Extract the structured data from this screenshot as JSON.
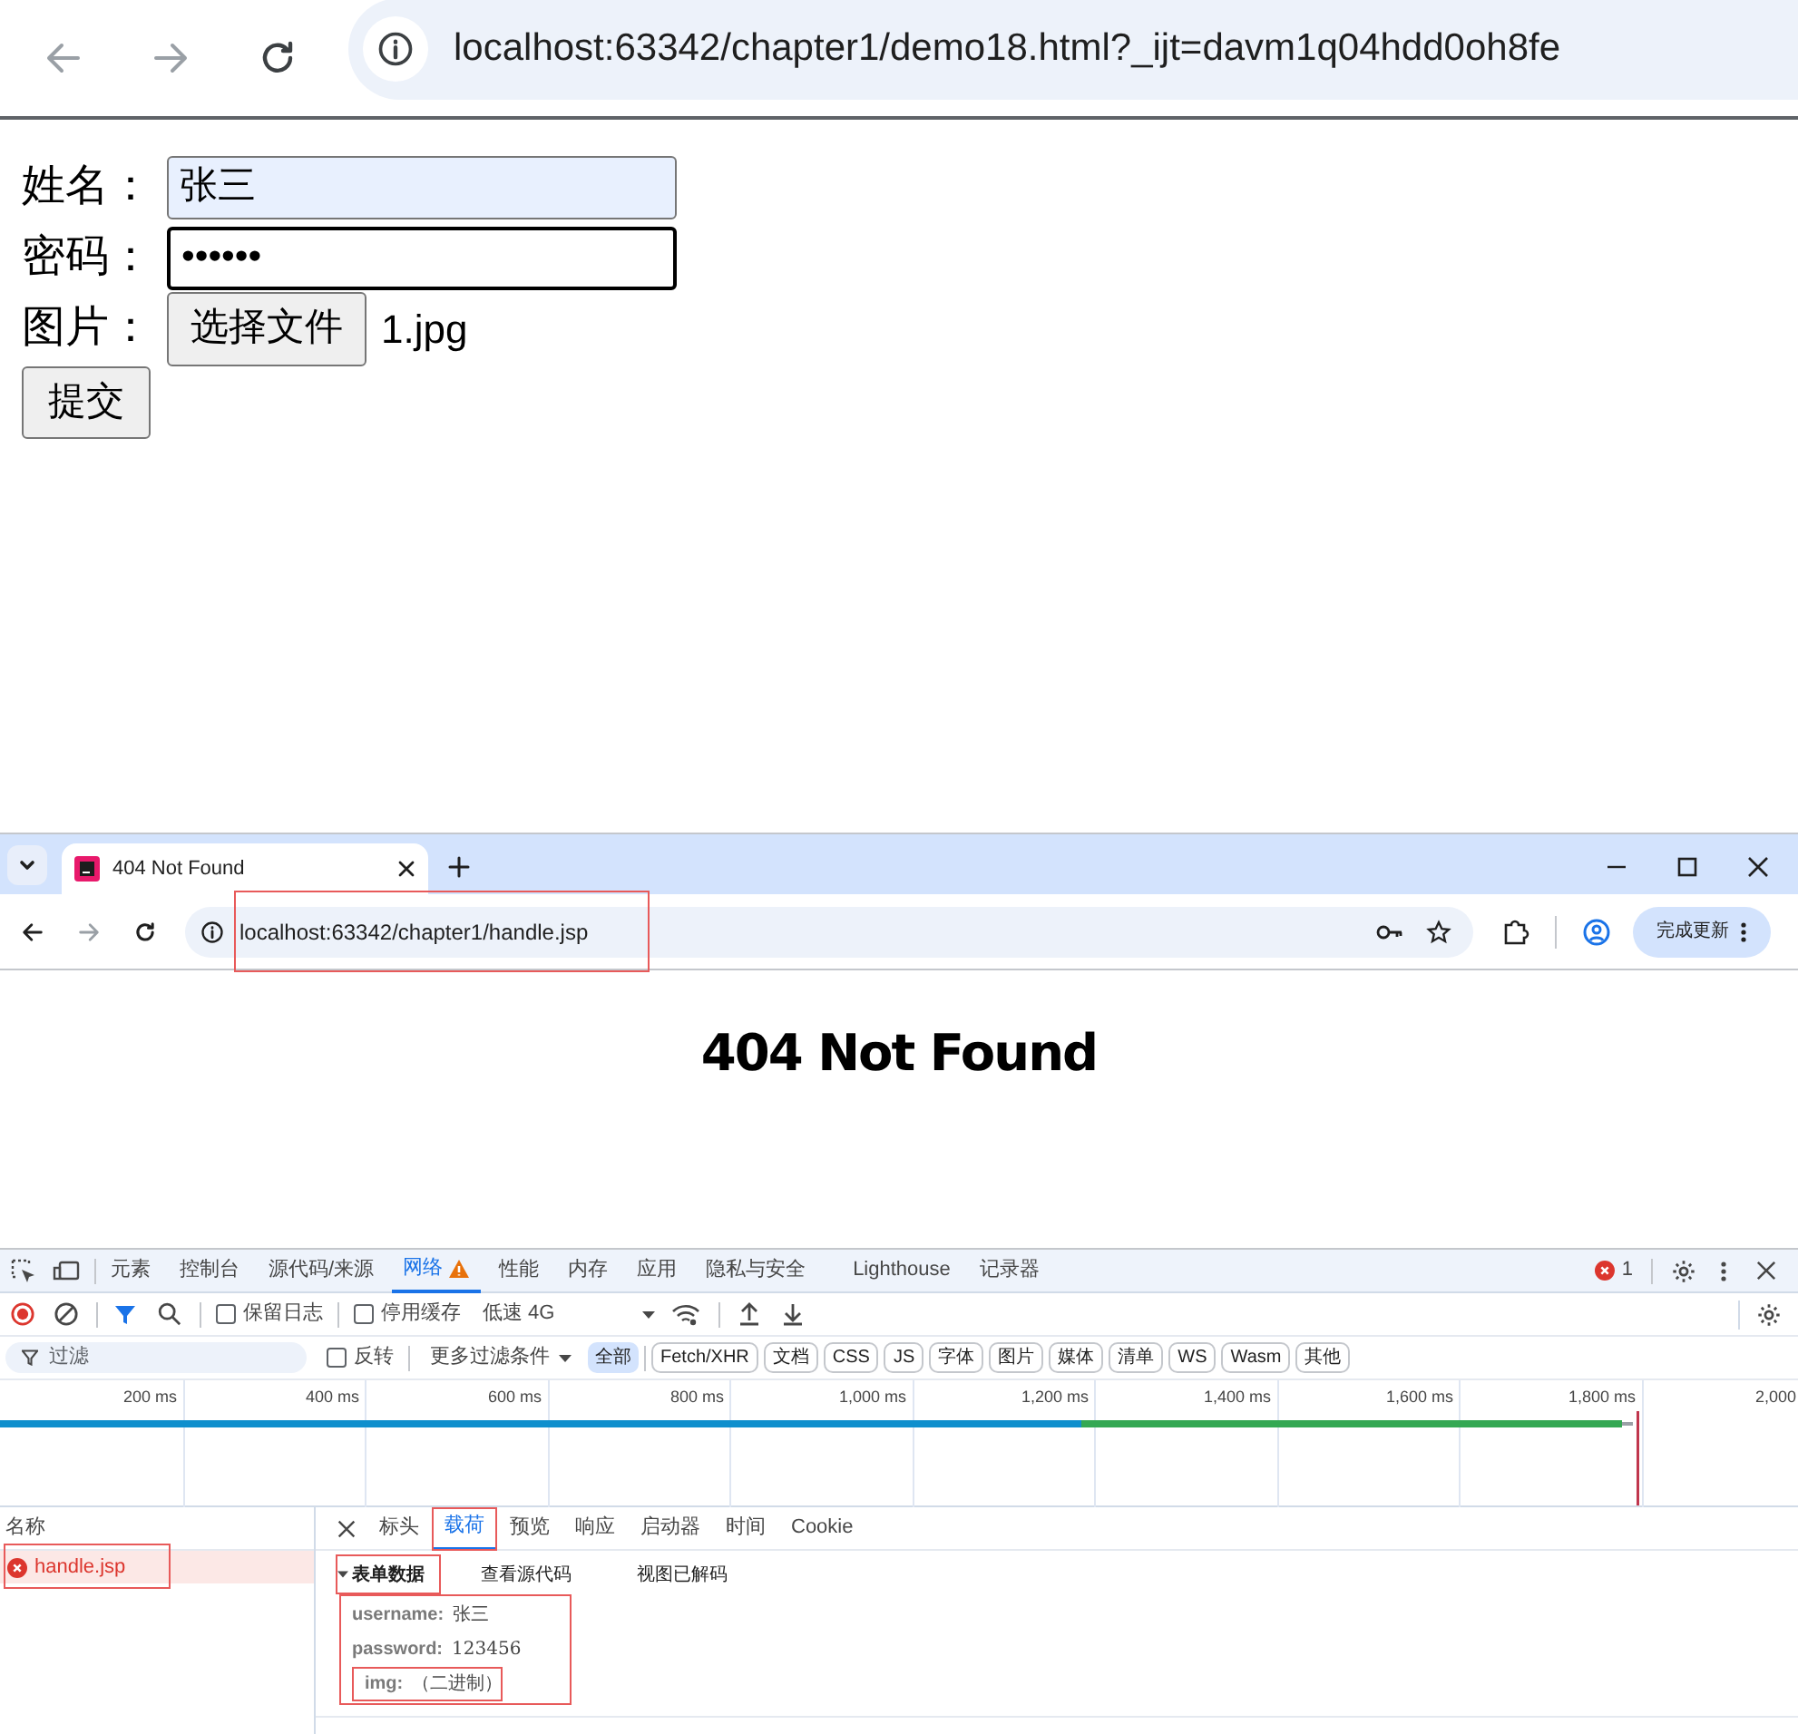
{
  "top_browser": {
    "url": "localhost:63342/chapter1/demo18.html?_ijt=davm1q04hdd0oh8fe"
  },
  "form": {
    "rows": [
      {
        "kind": "text",
        "label": "姓名：",
        "value": "张三",
        "autofilled": true,
        "focused": false
      },
      {
        "kind": "password",
        "label": "密码：",
        "value": "••••••",
        "autofilled": false,
        "focused": true
      },
      {
        "kind": "file",
        "label": "图片：",
        "button": "选择文件",
        "file_name": "1.jpg"
      }
    ],
    "submit": "提交"
  },
  "second_browser": {
    "tab_title": "404 Not Found",
    "url": "localhost:63342/chapter1/handle.jsp",
    "url_highlighted": true,
    "update_button": "完成更新",
    "heading": "404 Not Found"
  },
  "devtools": {
    "tabs": [
      {
        "label": "元素",
        "selected": false
      },
      {
        "label": "控制台",
        "selected": false
      },
      {
        "label": "源代码/来源",
        "selected": false
      },
      {
        "label": "网络",
        "selected": true,
        "warning": true
      },
      {
        "label": "性能",
        "selected": false
      },
      {
        "label": "内存",
        "selected": false
      },
      {
        "label": "应用",
        "selected": false
      },
      {
        "label": "隐私与安全",
        "selected": false
      },
      {
        "label": "Lighthouse",
        "selected": false
      },
      {
        "label": "记录器",
        "selected": false
      }
    ],
    "error_count": "1",
    "toolbar": {
      "recording": true,
      "options": [
        {
          "label": "保留日志",
          "checked": false
        },
        {
          "label": "停用缓存",
          "checked": false
        }
      ],
      "throttle": "低速 4G"
    },
    "filter": {
      "placeholder": "过滤",
      "invert": {
        "label": "反转",
        "checked": false
      },
      "more": "更多过滤条件",
      "types": [
        {
          "label": "全部",
          "selected": true
        },
        {
          "label": "Fetch/XHR",
          "selected": false
        },
        {
          "label": "文档",
          "selected": false
        },
        {
          "label": "CSS",
          "selected": false
        },
        {
          "label": "JS",
          "selected": false
        },
        {
          "label": "字体",
          "selected": false
        },
        {
          "label": "图片",
          "selected": false
        },
        {
          "label": "媒体",
          "selected": false
        },
        {
          "label": "清单",
          "selected": false
        },
        {
          "label": "WS",
          "selected": false
        },
        {
          "label": "Wasm",
          "selected": false
        },
        {
          "label": "其他",
          "selected": false
        }
      ]
    },
    "timeline": {
      "ticks": [
        "200 ms",
        "400 ms",
        "600 ms",
        "800 ms",
        "1,000 ms",
        "1,200 ms",
        "1,400 ms",
        "1,600 ms",
        "1,800 ms",
        "2,000"
      ]
    },
    "requests": {
      "header": "名称",
      "rows": [
        {
          "name": "handle.jsp",
          "error": true,
          "selected": true,
          "highlighted": true
        }
      ]
    },
    "detail_tabs": [
      {
        "label": "标头",
        "selected": false,
        "highlighted": false
      },
      {
        "label": "载荷",
        "selected": true,
        "highlighted": true
      },
      {
        "label": "预览",
        "selected": false,
        "highlighted": false
      },
      {
        "label": "响应",
        "selected": false,
        "highlighted": false
      },
      {
        "label": "启动器",
        "selected": false,
        "highlighted": false
      },
      {
        "label": "时间",
        "selected": false,
        "highlighted": false
      },
      {
        "label": "Cookie",
        "selected": false,
        "highlighted": false
      }
    ],
    "payload": {
      "section": "表单数据",
      "expanded": true,
      "section_highlighted": true,
      "actions": [
        "查看源代码",
        "视图已解码"
      ],
      "fields_highlighted": true,
      "fields": [
        {
          "key": "username:",
          "value": "张三",
          "highlighted": false
        },
        {
          "key": "password:",
          "value": "123456",
          "highlighted": false
        },
        {
          "key": "img:",
          "value": "（二进制）",
          "highlighted": true
        }
      ]
    }
  }
}
